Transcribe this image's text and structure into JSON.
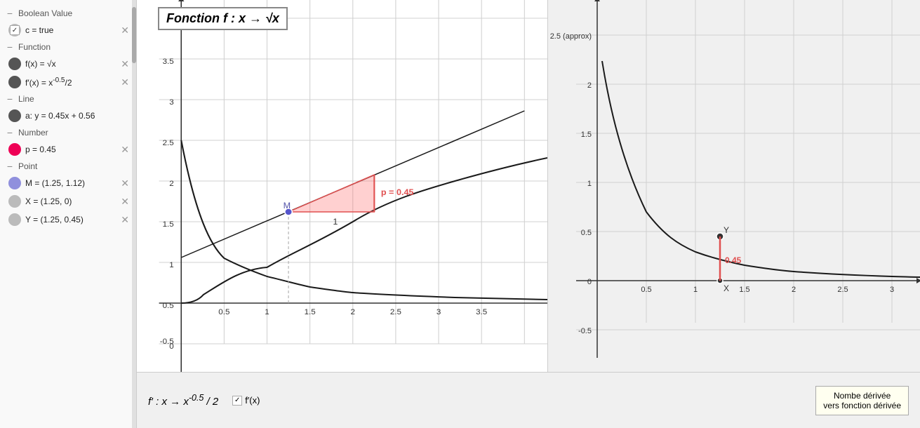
{
  "sidebar": {
    "sections": [
      {
        "name": "Boolean Value",
        "items": [
          {
            "type": "checkbox",
            "label": "c = true",
            "checked": true
          }
        ]
      },
      {
        "name": "Function",
        "items": [
          {
            "type": "dot",
            "color": "dark",
            "label": "f(x) = √x",
            "label_math": "f(x) = √x",
            "hasClose": true
          },
          {
            "type": "dot",
            "color": "dark",
            "label": "f′(x) = x⁻⁰·⁵/2",
            "hasClose": true
          }
        ]
      },
      {
        "name": "Line",
        "items": [
          {
            "type": "dot",
            "color": "dark",
            "label": "a: y = 0.45x + 0.56",
            "hasClose": false
          }
        ]
      },
      {
        "name": "Number",
        "items": [
          {
            "type": "dot",
            "color": "red",
            "label": "p = 0.45",
            "hasClose": true
          }
        ]
      },
      {
        "name": "Point",
        "items": [
          {
            "type": "dot",
            "color": "lavender",
            "label": "M = (1.25, 1.12)",
            "hasClose": true
          },
          {
            "type": "dot",
            "color": "light-gray",
            "label": "X = (1.25, 0)",
            "hasClose": true
          },
          {
            "type": "dot",
            "color": "light-gray",
            "label": "Y = (1.25, 0.45)",
            "hasClose": true
          }
        ]
      }
    ],
    "scrollbar": true
  },
  "left_chart": {
    "formula_box": "Fonction f : x → √x",
    "x_axis_labels": [
      "0",
      "0.5",
      "1",
      "1.5",
      "2",
      "2.5",
      "3",
      "3.5"
    ],
    "y_axis_labels": [
      "-0.5",
      "0",
      "0.5",
      "1",
      "1.5",
      "2",
      "2.5",
      "3",
      "3.5"
    ],
    "point_M_label": "M",
    "point_M_coords": "(1.25, 1.12)",
    "p_label": "p = 0.45",
    "label_1": "1"
  },
  "right_chart": {
    "x_axis_labels": [
      "0",
      "0.5",
      "1",
      "1.5",
      "2",
      "2.5",
      "3"
    ],
    "y_axis_labels": [
      "-0.5",
      "0",
      "0.5",
      "1",
      "1.5",
      "2"
    ],
    "point_Y_label": "Y",
    "point_X_label": "X",
    "value_045": "0.45"
  },
  "bottom_panel": {
    "derivative_formula": "f′ : x → x⁻⁰·⁵ / 2",
    "checkbox_label": "f′(x)",
    "info_title": "Nombe dérivée",
    "info_subtitle": "vers fonction dérivée"
  },
  "colors": {
    "accent_red": "#e05050",
    "curve_dark": "#1a1a1a",
    "point_blue": "#5050cc",
    "shading_pink": "rgba(255,150,150,0.35)",
    "grid": "#d0d0d0"
  }
}
